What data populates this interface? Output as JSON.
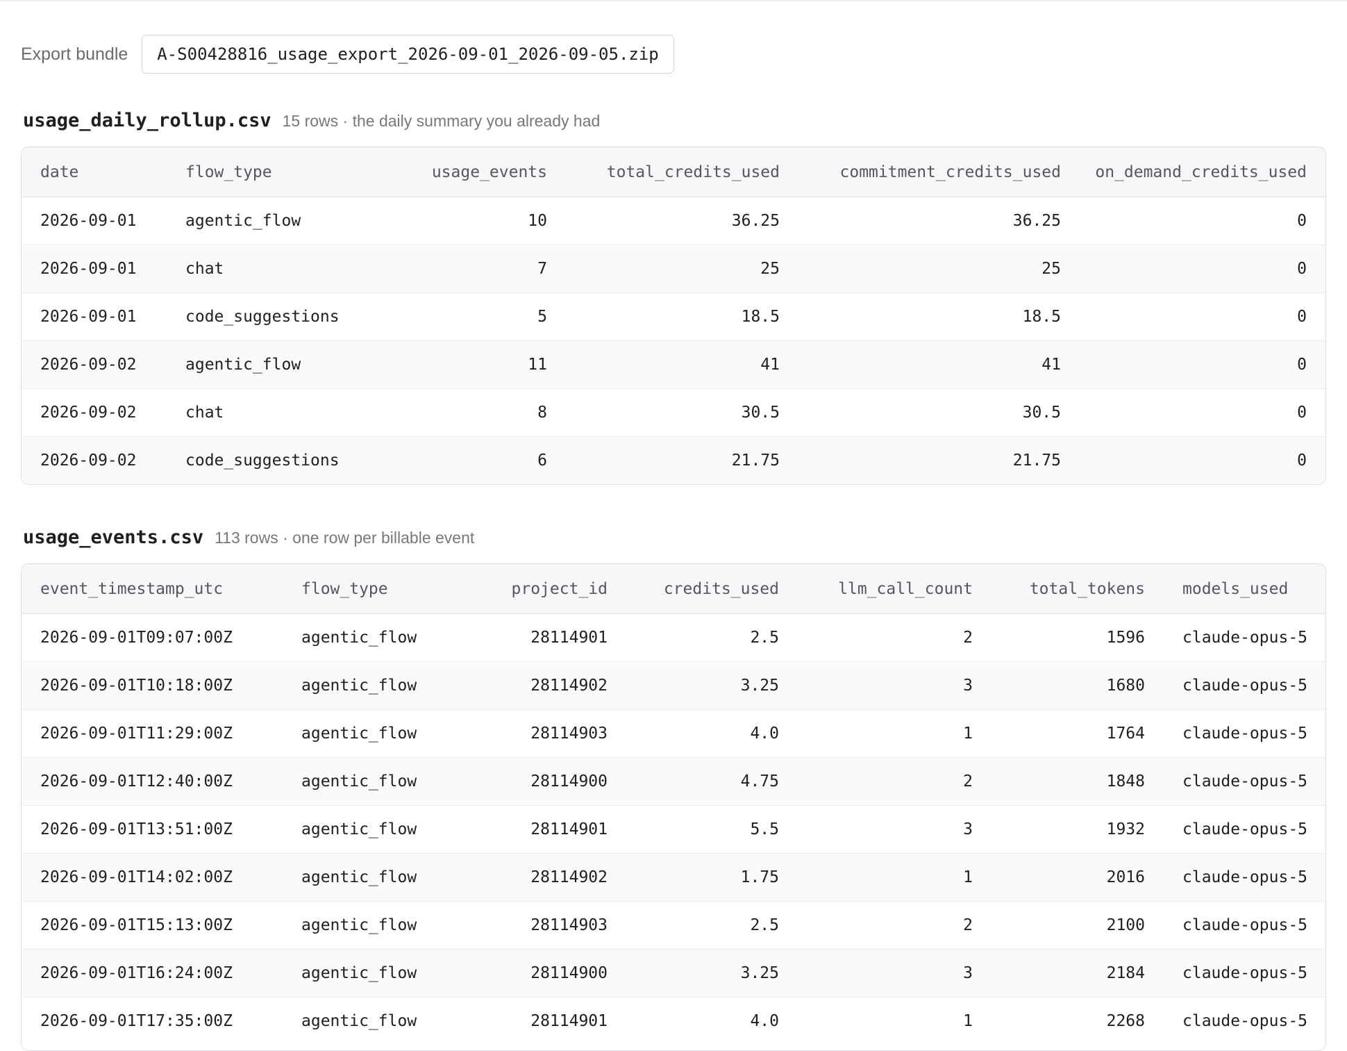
{
  "export": {
    "label": "Export bundle",
    "filename": "A-S00428816_usage_export_2026-09-01_2026-09-05.zip"
  },
  "rollup": {
    "file": "usage_daily_rollup.csv",
    "meta": "15 rows · the daily summary you already had",
    "columns": [
      "date",
      "flow_type",
      "usage_events",
      "total_credits_used",
      "commitment_credits_used",
      "on_demand_credits_used"
    ],
    "rows": [
      [
        "2026-09-01",
        "agentic_flow",
        "10",
        "36.25",
        "36.25",
        "0"
      ],
      [
        "2026-09-01",
        "chat",
        "7",
        "25",
        "25",
        "0"
      ],
      [
        "2026-09-01",
        "code_suggestions",
        "5",
        "18.5",
        "18.5",
        "0"
      ],
      [
        "2026-09-02",
        "agentic_flow",
        "11",
        "41",
        "41",
        "0"
      ],
      [
        "2026-09-02",
        "chat",
        "8",
        "30.5",
        "30.5",
        "0"
      ],
      [
        "2026-09-02",
        "code_suggestions",
        "6",
        "21.75",
        "21.75",
        "0"
      ]
    ]
  },
  "events": {
    "file": "usage_events.csv",
    "meta": "113 rows · one row per billable event",
    "columns": [
      "event_timestamp_utc",
      "flow_type",
      "project_id",
      "credits_used",
      "llm_call_count",
      "total_tokens",
      "models_used"
    ],
    "rows": [
      [
        "2026-09-01T09:07:00Z",
        "agentic_flow",
        "28114901",
        "2.5",
        "2",
        "1596",
        "claude-opus-5"
      ],
      [
        "2026-09-01T10:18:00Z",
        "agentic_flow",
        "28114902",
        "3.25",
        "3",
        "1680",
        "claude-opus-5"
      ],
      [
        "2026-09-01T11:29:00Z",
        "agentic_flow",
        "28114903",
        "4.0",
        "1",
        "1764",
        "claude-opus-5"
      ],
      [
        "2026-09-01T12:40:00Z",
        "agentic_flow",
        "28114900",
        "4.75",
        "2",
        "1848",
        "claude-opus-5"
      ],
      [
        "2026-09-01T13:51:00Z",
        "agentic_flow",
        "28114901",
        "5.5",
        "3",
        "1932",
        "claude-opus-5"
      ],
      [
        "2026-09-01T14:02:00Z",
        "agentic_flow",
        "28114902",
        "1.75",
        "1",
        "2016",
        "claude-opus-5"
      ],
      [
        "2026-09-01T15:13:00Z",
        "agentic_flow",
        "28114903",
        "2.5",
        "2",
        "2100",
        "claude-opus-5"
      ],
      [
        "2026-09-01T16:24:00Z",
        "agentic_flow",
        "28114900",
        "3.25",
        "3",
        "2184",
        "claude-opus-5"
      ],
      [
        "2026-09-01T17:35:00Z",
        "agentic_flow",
        "28114901",
        "4.0",
        "1",
        "2268",
        "claude-opus-5"
      ]
    ]
  }
}
